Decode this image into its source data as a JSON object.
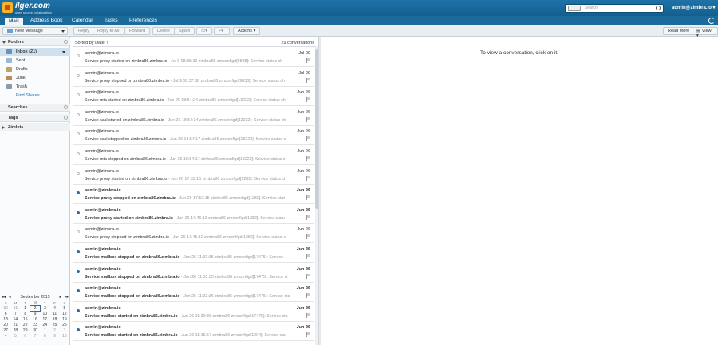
{
  "app": {
    "logo_name": "ilger.com",
    "logo_tagline": "open source collaboration",
    "search_placeholder": "Search",
    "user": "admin@zimbra.io ▾"
  },
  "nav": {
    "tabs": [
      "Mail",
      "Address Book",
      "Calendar",
      "Tasks",
      "Preferences"
    ],
    "active": "Mail"
  },
  "toolbar": {
    "new_message": "New Message",
    "reply": "Reply",
    "reply_all": "Reply to All",
    "forward": "Forward",
    "delete": "Delete",
    "spam": "Spam",
    "actions": "Actions ▾",
    "read_more": "Read More",
    "view": "View ▾"
  },
  "sidebar": {
    "folders_header": "Folders",
    "folders": [
      {
        "label": "Inbox (21)",
        "icon": "inbox-icon",
        "color": "#6a8fb8"
      },
      {
        "label": "Sent",
        "icon": "sent-icon",
        "color": "#9bb7d4"
      },
      {
        "label": "Drafts",
        "icon": "drafts-icon",
        "color": "#b9a46a"
      },
      {
        "label": "Junk",
        "icon": "junk-icon",
        "color": "#b58c5a"
      },
      {
        "label": "Trash",
        "icon": "trash-icon",
        "color": "#8d9aa5"
      }
    ],
    "find_shares": "Find Shares...",
    "searches_header": "Searches",
    "tags_header": "Tags",
    "zimlets_header": "Zimlets"
  },
  "calendar": {
    "month_label": "September 2015",
    "weekdays": [
      "S",
      "M",
      "T",
      "W",
      "T",
      "F",
      "S"
    ],
    "weeks": [
      [
        "30",
        "31",
        "1",
        "2",
        "3",
        "4",
        "5"
      ],
      [
        "6",
        "7",
        "8",
        "9",
        "10",
        "11",
        "12"
      ],
      [
        "13",
        "14",
        "15",
        "16",
        "17",
        "18",
        "19"
      ],
      [
        "20",
        "21",
        "22",
        "23",
        "24",
        "25",
        "26"
      ],
      [
        "27",
        "28",
        "29",
        "30",
        "1",
        "2",
        "3"
      ],
      [
        "4",
        "5",
        "6",
        "7",
        "8",
        "9",
        "10"
      ]
    ],
    "today": "2"
  },
  "list": {
    "sort_label": "Sorted by Date ⇡",
    "count_label": "29 conversations",
    "rows": [
      {
        "from": "admin@zimbra.io",
        "date": "Jul 09",
        "subject": "Service proxy started on zimbra86.zimbra.io",
        "fragment": " - Jul 9 08:38:39 zimbra86 zmconfigd[9838]: Service status ch",
        "unread": false
      },
      {
        "from": "admin@zimbra.io",
        "date": "Jul 09",
        "subject": "Service proxy stopped on zimbra86.zimbra.io",
        "fragment": " - Jul 9 08:37:38 zimbra86 zmconfigd[9838]: Service status ch",
        "unread": false
      },
      {
        "from": "admin@zimbra.io",
        "date": "Jun 26",
        "subject": "Service mta started on zimbra86.zimbra.io",
        "fragment": " - Jun 26 18:54:24 zimbra86 zmconfigd[13222]: Service status ch",
        "unread": false
      },
      {
        "from": "admin@zimbra.io",
        "date": "Jun 26",
        "subject": "Service sasl started on zimbra86.zimbra.io",
        "fragment": " - Jun 26 18:54:24 zimbra86 zmconfigd[13222]: Service status ch",
        "unread": false
      },
      {
        "from": "admin@zimbra.io",
        "date": "Jun 26",
        "subject": "Service sasl stopped on zimbra86.zimbra.io",
        "fragment": " - Jun 26 18:54:17 zimbra86 zmconfigd[13222]: Service status c",
        "unread": false
      },
      {
        "from": "admin@zimbra.io",
        "date": "Jun 26",
        "subject": "Service mta stopped on zimbra86.zimbra.io",
        "fragment": " - Jun 26 18:54:17 zimbra86 zmconfigd[13222]: Service status c",
        "unread": false
      },
      {
        "from": "admin@zimbra.io",
        "date": "Jun 26",
        "subject": "Service proxy started on zimbra86.zimbra.io",
        "fragment": " - Jun 26 17:53:16 zimbra86 zmconfigd[1282]: Service status ch",
        "unread": false
      },
      {
        "from": "admin@zimbra.io",
        "date": "Jun 26",
        "subject": "Service proxy stopped on zimbra86.zimbra.io",
        "fragment": " - Jun 26 17:52:15 zimbra86 zmconfigd[1282]: Service stat",
        "unread": true
      },
      {
        "from": "admin@zimbra.io",
        "date": "Jun 26",
        "subject": "Service proxy started on zimbra86.zimbra.io",
        "fragment": " - Jun 26 17:46:13 zimbra86 zmconfigd[1282]: Service statu",
        "unread": true
      },
      {
        "from": "admin@zimbra.io",
        "date": "Jun 26",
        "subject": "Service proxy stopped on zimbra86.zimbra.io",
        "fragment": " - Jun 26 17:45:12 zimbra86 zmconfigd[1282]: Service status c",
        "unread": false
      },
      {
        "from": "admin@zimbra.io",
        "date": "Jun 26",
        "subject": "Service mailbox stopped on zimbra86.zimbra.io",
        "fragment": " - Jun 26 11:31:35 zimbra86 zmconfigd[17475]: Service",
        "unread": true
      },
      {
        "from": "admin@zimbra.io",
        "date": "Jun 26",
        "subject": "Service mailbox stopped on zimbra86.zimbra.io",
        "fragment": " - Jun 26 11:31:35 zimbra86 zmconfigd[17475]: Service st",
        "unread": true
      },
      {
        "from": "admin@zimbra.io",
        "date": "Jun 26",
        "subject": "Service mailbox stopped on zimbra86.zimbra.io",
        "fragment": " - Jun 26 11:32:36 zimbra86 zmconfigd[17475]: Service sta",
        "unread": true
      },
      {
        "from": "admin@zimbra.io",
        "date": "Jun 26",
        "subject": "Service mailbox started on zimbra86.zimbra.io",
        "fragment": " - Jun 26 11:32:36 zimbra86 zmconfigd[17475]: Service sta",
        "unread": true
      },
      {
        "from": "admin@zimbra.io",
        "date": "Jun 26",
        "subject": "Service mailbox started on zimbra86.zimbra.io",
        "fragment": " - Jun 26 11:15:57 zimbra86 zmconfigd[1294]: Service sta",
        "unread": true
      }
    ]
  },
  "reading": {
    "empty_message": "To view a conversation, click on it."
  }
}
